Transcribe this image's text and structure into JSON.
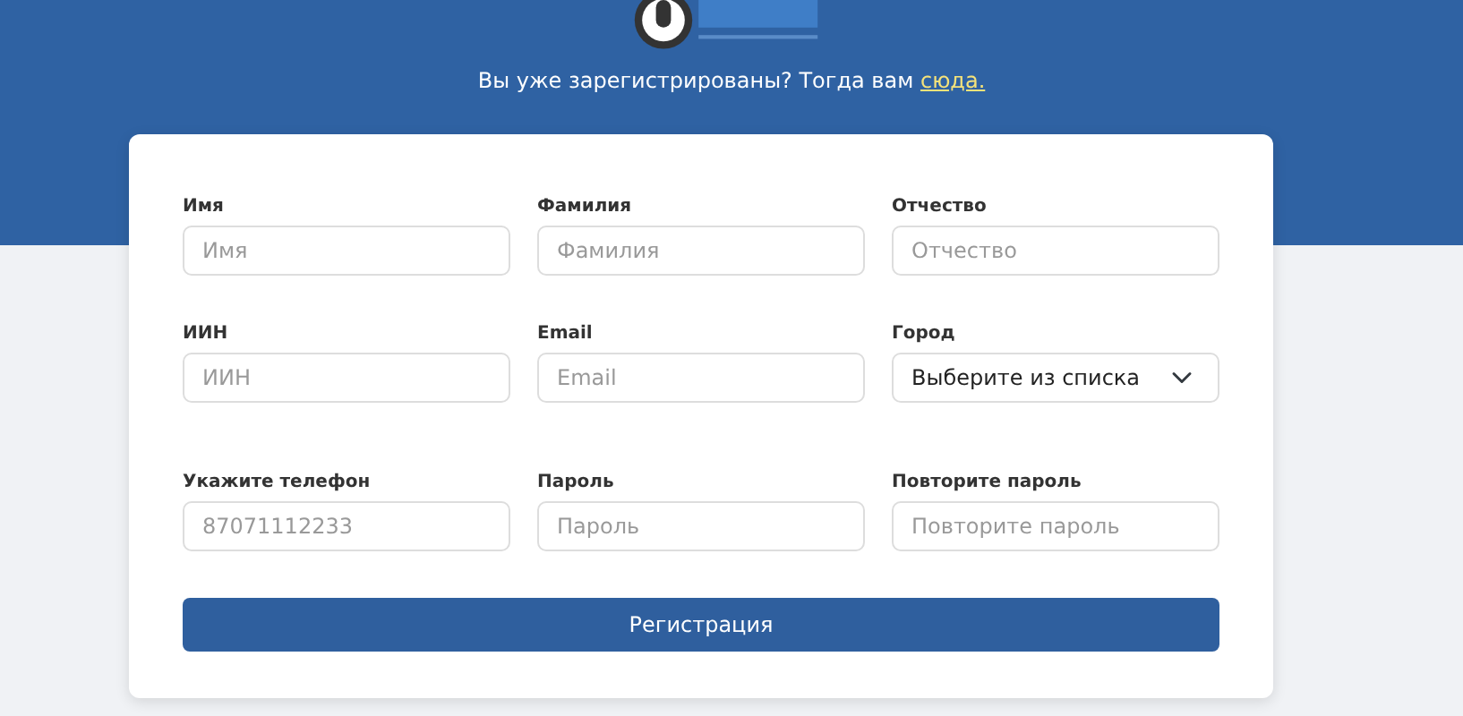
{
  "header": {
    "text": "Вы уже зарегистрированы? Тогда вам ",
    "link": "сюда."
  },
  "rows": [
    {
      "fields": [
        {
          "kind": "input",
          "label": "Имя",
          "placeholder": "Имя"
        },
        {
          "kind": "input",
          "label": "Фамилия",
          "placeholder": "Фамилия"
        },
        {
          "kind": "input",
          "label": "Отчество",
          "placeholder": "Отчество"
        }
      ]
    },
    {
      "fields": [
        {
          "kind": "input",
          "label": "ИИН",
          "placeholder": "ИИН"
        },
        {
          "kind": "input",
          "label": "Email",
          "placeholder": "Email"
        },
        {
          "kind": "select",
          "label": "Город",
          "value": "Выберите из списка"
        }
      ]
    },
    {
      "fields": [
        {
          "kind": "input",
          "label": "Укажите телефон",
          "placeholder": "87071112233"
        },
        {
          "kind": "input",
          "label": "Пароль",
          "placeholder": "Пароль"
        },
        {
          "kind": "input",
          "label": "Повторите пароль",
          "placeholder": "Повторите пароль"
        }
      ]
    }
  ],
  "submit": "Регистрация"
}
